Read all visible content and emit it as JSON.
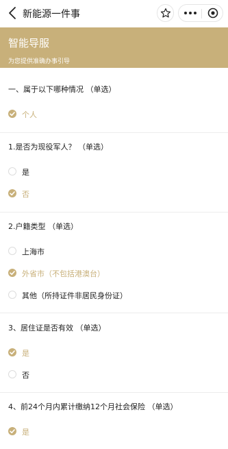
{
  "nav": {
    "title": "新能源一件事"
  },
  "banner": {
    "title": "智能导服",
    "subtitle": "为您提供准确办事引导"
  },
  "colors": {
    "accent": "#c8b07a",
    "unselected_border": "#dcdcdc"
  },
  "questions": [
    {
      "title": "一、属于以下哪种情况 （单选）",
      "options": [
        {
          "label": "个人",
          "selected": true
        }
      ]
    },
    {
      "title": "1.是否为现役军人？ （单选）",
      "options": [
        {
          "label": "是",
          "selected": false
        },
        {
          "label": "否",
          "selected": true
        }
      ]
    },
    {
      "title": "2.户籍类型 （单选）",
      "options": [
        {
          "label": "上海市",
          "selected": false
        },
        {
          "label": "外省市（不包括港澳台）",
          "selected": true
        },
        {
          "label": "其他（所持证件非居民身份证）",
          "selected": false
        }
      ]
    },
    {
      "title": "3、居住证是否有效 （单选）",
      "options": [
        {
          "label": "是",
          "selected": true
        },
        {
          "label": "否",
          "selected": false
        }
      ]
    },
    {
      "title": "4、前24个月内累计缴纳12个月社会保险 （单选）",
      "options": [
        {
          "label": "是",
          "selected": true
        }
      ]
    }
  ]
}
